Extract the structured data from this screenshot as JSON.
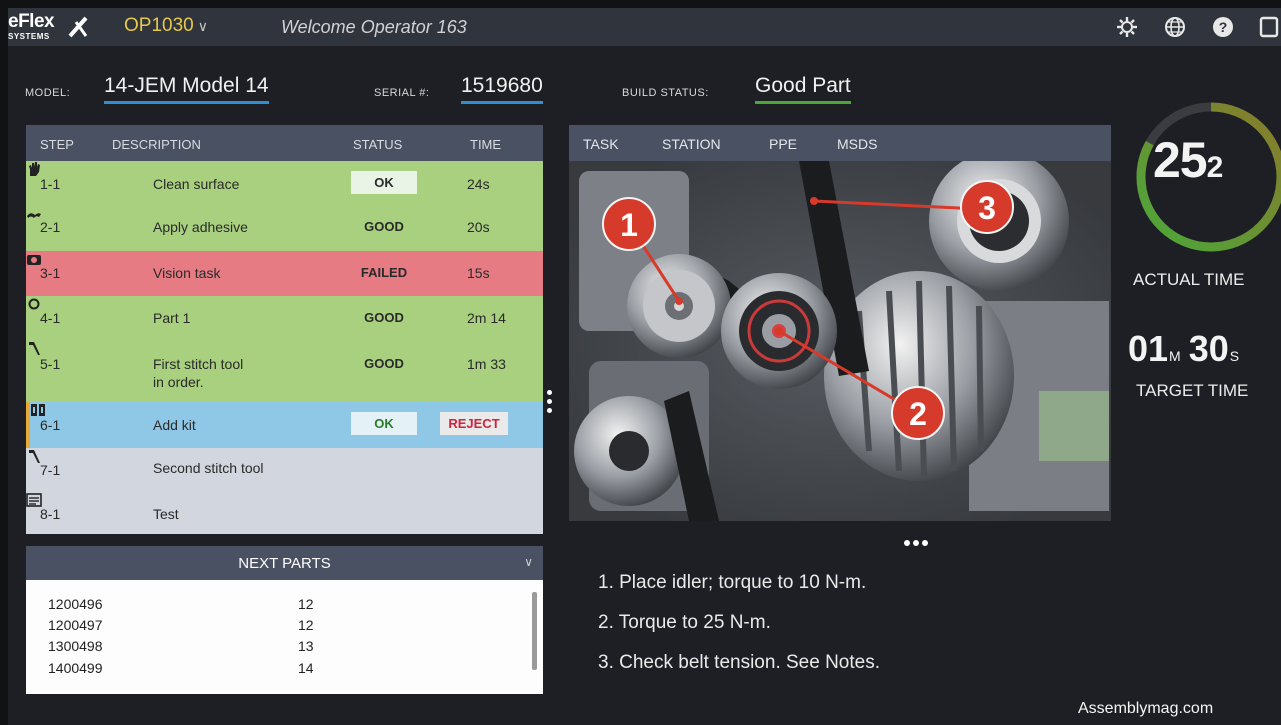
{
  "app": {
    "logo_top": "eFlex",
    "logo_bottom": "SYSTEMS",
    "operation": "OP1030",
    "welcome": "Welcome Operator 163"
  },
  "topbar_icons": [
    "gear-icon",
    "globe-icon",
    "help-icon",
    "panel-icon"
  ],
  "header": {
    "model_label": "MODEL:",
    "model_value": "14-JEM Model 14",
    "serial_label": "SERIAL #:",
    "serial_value": "1519680",
    "build_label": "BUILD STATUS:",
    "build_value": "Good Part"
  },
  "steps_table": {
    "columns": {
      "step": "STEP",
      "description": "DESCRIPTION",
      "status": "STATUS",
      "time": "TIME"
    },
    "rows": [
      {
        "step": "1-1",
        "icon": "hand-icon",
        "description": "Clean surface",
        "status": "OK",
        "time": "24s",
        "state": "good"
      },
      {
        "step": "2-1",
        "icon": "adhesive-icon",
        "description": "Apply adhesive",
        "status": "GOOD",
        "time": "20s",
        "state": "good"
      },
      {
        "step": "3-1",
        "icon": "camera-icon",
        "description": "Vision task",
        "status": "FAILED",
        "time": "15s",
        "state": "failed"
      },
      {
        "step": "4-1",
        "icon": "circle-icon",
        "description": "Part 1",
        "status": "GOOD",
        "time": "2m 14",
        "state": "good"
      },
      {
        "step": "5-1",
        "icon": "stitch-tool-icon",
        "description": "First stitch tool",
        "description2": "in order.",
        "status": "GOOD",
        "time": "1m 33",
        "state": "good"
      },
      {
        "step": "6-1",
        "icon": "kit-icon",
        "description": "Add kit",
        "status": "OK",
        "reject": "REJECT",
        "time": "",
        "state": "active"
      },
      {
        "step": "7-1",
        "icon": "stitch-tool-icon",
        "description": "Second stitch tool",
        "status": "",
        "time": "",
        "state": "pending"
      },
      {
        "step": "8-1",
        "icon": "test-icon",
        "description": "Test",
        "status": "",
        "time": "",
        "state": "pending"
      }
    ]
  },
  "next_parts": {
    "title": "NEXT PARTS",
    "items": [
      {
        "part": "1200496",
        "qty": "12"
      },
      {
        "part": "1200497",
        "qty": "12"
      },
      {
        "part": "1300498",
        "qty": "13"
      },
      {
        "part": "1400499",
        "qty": "14"
      }
    ]
  },
  "task_panel": {
    "tabs": [
      "TASK",
      "STATION",
      "PPE",
      "MSDS"
    ],
    "markers": [
      "1",
      "2",
      "3"
    ],
    "instructions": [
      "1. Place idler; torque to 10 N-m.",
      "2. Torque to 25 N-m.",
      "3. Check belt tension.  See Notes."
    ]
  },
  "timer": {
    "actual_main": "25",
    "actual_sub": "2",
    "actual_label": "ACTUAL TIME",
    "target_min": "01",
    "target_min_unit": "M",
    "target_sec": "30",
    "target_sec_unit": "S",
    "target_label": "TARGET TIME",
    "progress_fraction": 0.83,
    "colors": {
      "ring_start": "#4aa83a",
      "ring_end": "#8a7a2a"
    }
  },
  "credit": "Assemblymag.com"
}
